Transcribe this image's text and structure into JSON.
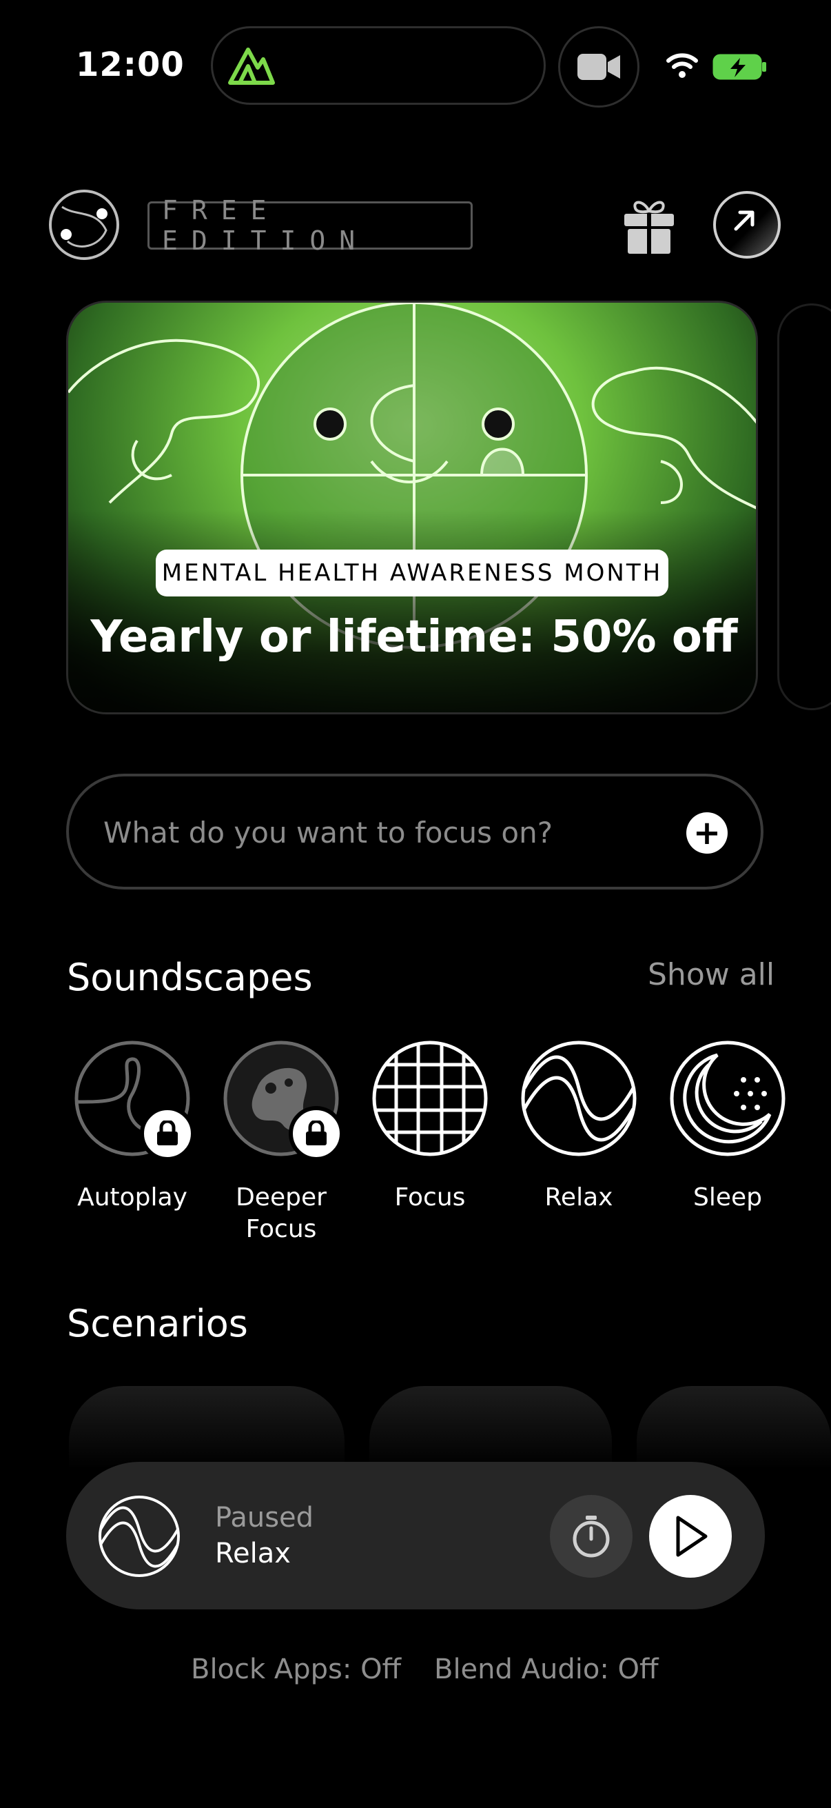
{
  "status_bar": {
    "time": "12:00"
  },
  "header": {
    "edition_label": "FREE EDITION"
  },
  "banner": {
    "tag": "MENTAL HEALTH AWARENESS MONTH",
    "title": "Yearly or lifetime: 50% off"
  },
  "focus": {
    "placeholder": "What do you want to focus on?"
  },
  "soundscapes": {
    "title": "Soundscapes",
    "show_all": "Show all",
    "items": [
      {
        "label": "Autoplay",
        "locked": true
      },
      {
        "label": "Deeper Focus",
        "locked": true
      },
      {
        "label": "Focus",
        "locked": false
      },
      {
        "label": "Relax",
        "locked": false
      },
      {
        "label": "Sleep",
        "locked": false
      }
    ]
  },
  "scenarios": {
    "title": "Scenarios"
  },
  "player": {
    "status": "Paused",
    "track": "Relax"
  },
  "footer": {
    "block_apps": "Block Apps: Off",
    "blend_audio": "Blend Audio: Off"
  },
  "colors": {
    "accent_green": "#7dd94a",
    "background": "#000000",
    "player_bg": "#262626"
  }
}
